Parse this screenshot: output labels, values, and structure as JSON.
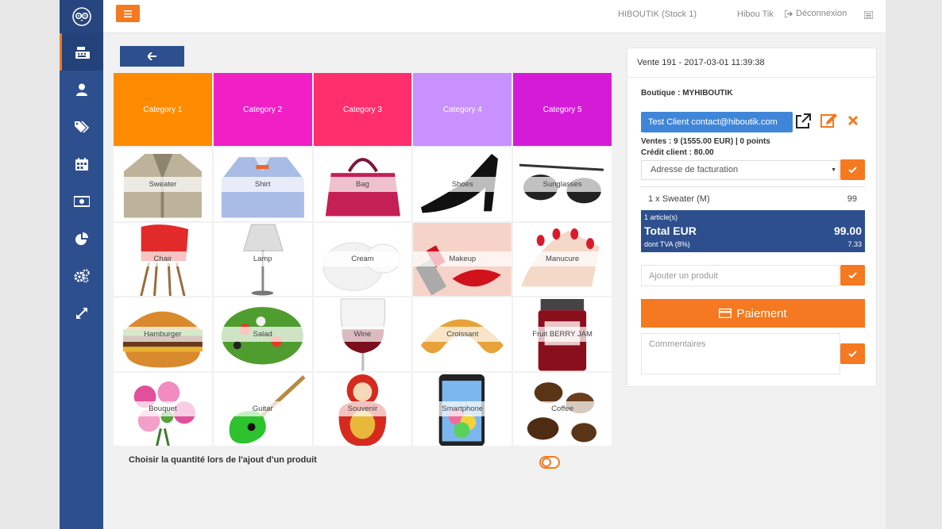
{
  "topbar": {
    "stock": "HIBOUTIK (Stock 1)",
    "user": "Hibou Tik",
    "logout": "Déconnexion"
  },
  "sidebar": {
    "items": [
      "cash-register-icon",
      "user-icon",
      "tags-icon",
      "calendar-icon",
      "money-icon",
      "pie-chart-icon",
      "settings-icon",
      "expand-icon"
    ]
  },
  "categories": [
    {
      "label": "Category 1",
      "color": "#ff8c00"
    },
    {
      "label": "Category 2",
      "color": "#f01fc6"
    },
    {
      "label": "Category 3",
      "color": "#ff2f6e"
    },
    {
      "label": "Category 4",
      "color": "#c991ff"
    },
    {
      "label": "Category 5",
      "color": "#d61bd8"
    }
  ],
  "products": [
    "Sweater",
    "Shirt",
    "Bag",
    "Shoes",
    "Sunglasses",
    "Chair",
    "Lamp",
    "Cream",
    "Makeup",
    "Manucure",
    "Hamburger",
    "Salad",
    "Wine",
    "Croissant",
    "Fruit BERRY JAM",
    "Bouquet",
    "Guitar",
    "Souvenir",
    "Smartphone",
    "Coffee"
  ],
  "options": {
    "qty_label": "Choisir la quantité lors de l'ajout d'un produit"
  },
  "sale": {
    "header": "Vente 191 - 2017-03-01 11:39:38",
    "shop": "Boutique : MYHIBOUTIK",
    "client": "Test Client contact@hiboutik.com",
    "sales_summary": "Ventes : 9 (1555.00 EUR) | 0 points",
    "credit": "Crédit client : 80.00",
    "address": "Adresse de facturation",
    "line_name": "1 x Sweater (M)",
    "line_price": "99",
    "articles": "1 article(s)",
    "total_label": "Total EUR",
    "total_value": "99.00",
    "vat_label": "dont TVA (8%)",
    "vat_value": "7.33",
    "add_placeholder": "Ajouter un produit",
    "pay_label": "Paiement",
    "comments_placeholder": "Commentaires"
  },
  "colors": {
    "accent": "#f47920",
    "primary": "#2d4f8e",
    "client_button": "#3f86d8"
  }
}
